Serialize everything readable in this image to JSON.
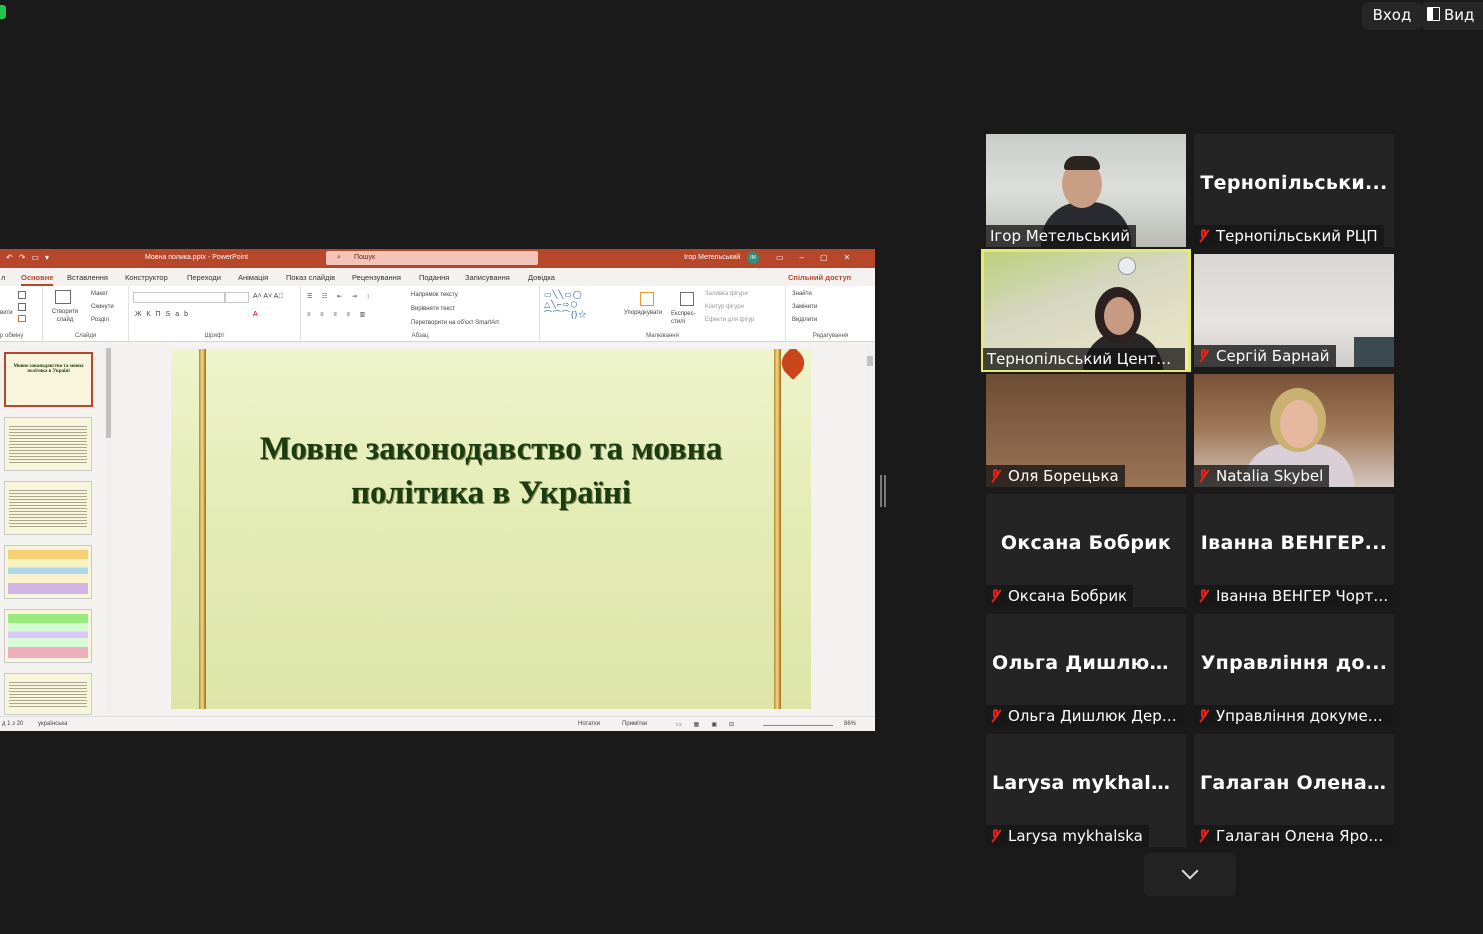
{
  "top_bar": {
    "login_label": "Вход",
    "view_label": "Вид"
  },
  "powerpoint": {
    "window_title": "Мовна полика.pptx  -  PowerPoint",
    "search_placeholder": "Пошук",
    "user_name": "Ігор Метельський",
    "user_initials": "ІМ",
    "tabs": [
      "л",
      "Основне",
      "Вставлення",
      "Конструктор",
      "Переходи",
      "Анімація",
      "Показ слайдів",
      "Рецензування",
      "Подання",
      "Записування",
      "Довідка"
    ],
    "active_tab": "Основне",
    "share_label": "Спільний доступ",
    "ribbon": {
      "slides": {
        "new_slide": "Створити слайд",
        "layout": "Макет",
        "reset": "Скинути",
        "section": "Розділ",
        "group": "Слайди"
      },
      "clipboard": {
        "insert": "вити",
        "group": "р обміну"
      },
      "font_group": "Шрифт",
      "paragraph": {
        "text_direction": "Напрямок тексту",
        "align_text": "Вирівняти текст",
        "convert_smartart": "Перетворити на об'єкт SmartArt",
        "group": "Абзац"
      },
      "drawing": {
        "arrange": "Упорядкувати",
        "quick_styles": "Експрес-стилі",
        "shape_fill": "Заливка фігури",
        "shape_outline": "Контур фігури",
        "shape_effects": "Ефекти для фігур",
        "group": "Малювання"
      },
      "editing": {
        "find": "Знайти",
        "replace": "Замінити",
        "select": "Виділити",
        "group": "Редагування"
      }
    },
    "thumbnail_1_title": "Мовне законодавство та мовна політика в Україні",
    "slide_title": "Мовне законодавство та мовна політика в Україні",
    "status": {
      "slide_counter": "д 1 з 20",
      "language": "українська",
      "notes": "Нотатки",
      "comments": "Примітки",
      "zoom": "86%"
    }
  },
  "participants": [
    {
      "display_name": "Ігор Метельський",
      "label": "Ігор Метельський",
      "video": true,
      "muted": false
    },
    {
      "display_name": "Тернопільськи...",
      "label": "Тернопільський РЦП",
      "video": false,
      "muted": true
    },
    {
      "display_name": "Тернопільський Центр ПК",
      "label": "Тернопільський Центр ПК",
      "video": true,
      "muted": false,
      "active_speaker": true
    },
    {
      "display_name": "Сергій Барнай",
      "label": "Сергій Барнай",
      "video": true,
      "muted": true
    },
    {
      "display_name": "Оля Борецька",
      "label": "Оля Борецька",
      "video": true,
      "muted": true
    },
    {
      "display_name": "Natalia Skybel",
      "label": "Natalia Skybel",
      "video": true,
      "muted": true
    },
    {
      "display_name": "Оксана Бобрик",
      "label": "Оксана Бобрик",
      "video": false,
      "muted": true
    },
    {
      "display_name": "Іванна ВЕНГЕР...",
      "label": "Іванна ВЕНГЕР Чорткі...",
      "video": false,
      "muted": true
    },
    {
      "display_name": "Ольга Дишлюк...",
      "label": "Ольга Дишлюк Держ...",
      "video": false,
      "muted": true
    },
    {
      "display_name": "Управління до...",
      "label": "Управління документ...",
      "video": false,
      "muted": true
    },
    {
      "display_name": "Larysa mykhalska",
      "label": "Larysa mykhalska",
      "video": false,
      "muted": true
    },
    {
      "display_name": "Галаган Олена...",
      "label": "Галаган Олена Яросла...",
      "video": false,
      "muted": true
    }
  ],
  "colors": {
    "app_background": "#1a1a1a",
    "powerpoint_accent": "#b7472a",
    "active_speaker_border": "#e6e96a",
    "muted_icon": "#e0261b"
  }
}
